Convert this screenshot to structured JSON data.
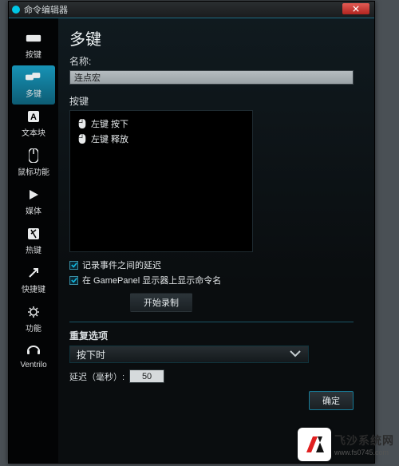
{
  "window": {
    "title": "命令编辑器"
  },
  "sidebar": {
    "items": [
      {
        "label": "按键"
      },
      {
        "label": "多键"
      },
      {
        "label": "文本块"
      },
      {
        "label": "鼠标功能"
      },
      {
        "label": "媒体"
      },
      {
        "label": "热键"
      },
      {
        "label": "快捷键"
      },
      {
        "label": "功能"
      },
      {
        "label": "Ventrilo"
      }
    ]
  },
  "main": {
    "heading": "多键",
    "name_label": "名称:",
    "name_value": "连点宏",
    "keys_label": "按键",
    "recorded": [
      "左键 按下",
      "左键 释放"
    ],
    "chk_record_delay": "记录事件之间的延迟",
    "chk_show_name": "在 GamePanel 显示器上显示命令名",
    "btn_record": "开始录制",
    "repeat_heading": "重复选项",
    "dropdown_value": "按下时",
    "delay_label": "延迟（毫秒）:",
    "delay_value": "50",
    "btn_ok": "确定"
  },
  "watermark": {
    "cn": "飞沙系统网",
    "url": "www.fs0745.com"
  }
}
